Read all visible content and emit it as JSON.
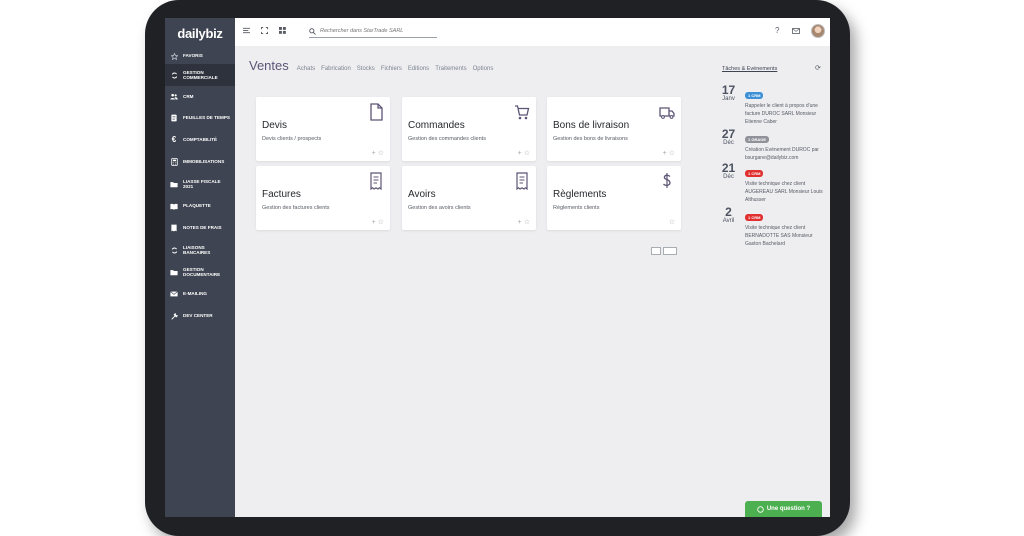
{
  "app": {
    "logo": "dailybiz"
  },
  "sidebar": {
    "items": [
      {
        "label": "Favoris",
        "icon": "star-icon"
      },
      {
        "label": "Gestion commerciale",
        "icon": "refresh-icon"
      },
      {
        "label": "CRM",
        "icon": "users-icon"
      },
      {
        "label": "Feuilles de temps",
        "icon": "timesheet-icon"
      },
      {
        "label": "Comptabilité",
        "icon": "euro-icon"
      },
      {
        "label": "Immobilisations",
        "icon": "calculator-icon"
      },
      {
        "label": "Liasse fiscale 2021",
        "icon": "folder-icon"
      },
      {
        "label": "Plaquette",
        "icon": "book-icon"
      },
      {
        "label": "Notes de frais",
        "icon": "receipt-icon"
      },
      {
        "label": "Liaisons bancaires",
        "icon": "bank-sync-icon"
      },
      {
        "label": "Gestion documentaire",
        "icon": "folder-open-icon"
      },
      {
        "label": "E-mailing",
        "icon": "email-icon"
      },
      {
        "label": "Dev Center",
        "icon": "wrench-icon"
      }
    ]
  },
  "topbar": {
    "search_placeholder": "Rechercher dans StarTrade SARL",
    "help": "?"
  },
  "nav": {
    "title": "Ventes",
    "links": [
      "Achats",
      "Fabrication",
      "Stocks",
      "Fichiers",
      "Editions",
      "Traitements",
      "Options"
    ]
  },
  "cards": [
    {
      "title": "Devis",
      "subtitle": "Devis clients / prospects",
      "icon": "document-icon"
    },
    {
      "title": "Commandes",
      "subtitle": "Gestion des commandes clients",
      "icon": "cart-icon"
    },
    {
      "title": "Bons de livraison",
      "subtitle": "Gestion des bons de livraisons",
      "icon": "truck-icon"
    },
    {
      "title": "Factures",
      "subtitle": "Gestion des factures clients",
      "icon": "invoice-icon"
    },
    {
      "title": "Avoirs",
      "subtitle": "Gestion des avoirs clients",
      "icon": "credit-note-icon"
    },
    {
      "title": "Règlements",
      "subtitle": "Règlements clients",
      "icon": "dollar-icon"
    }
  ],
  "panel": {
    "title": "Tâches & Evénements",
    "events": [
      {
        "day": "17",
        "month": "Janv",
        "badge": "1 CRM",
        "badge_color": "#3d8fd6",
        "text": "Rappeler le client à propos d'une facture DUROC SARL Monsieur Etienne Caber"
      },
      {
        "day": "27",
        "month": "Déc",
        "badge": "1 GRAGE",
        "badge_color": "#8f9399",
        "text": "Création Evénement DUROC par bsurgane@dailybiz.com"
      },
      {
        "day": "21",
        "month": "Déc",
        "badge": "1 CRM",
        "badge_color": "#e03030",
        "text": "Visite technique chez client AUGEREAU SARL Monsieur Louis Althusser"
      },
      {
        "day": "2",
        "month": "Avril",
        "badge": "1 CRM",
        "badge_color": "#e03030",
        "text": "Visite technique chez client BERNADOTTE SAS Monsieur Gaston Bachelard"
      }
    ]
  },
  "chat": {
    "label": "Une question ?"
  }
}
